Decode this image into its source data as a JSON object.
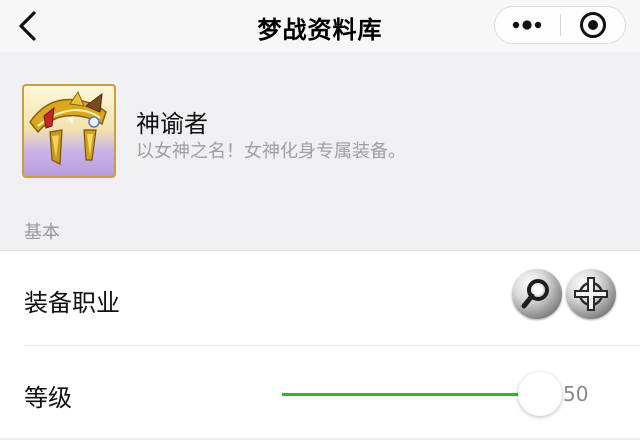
{
  "navbar": {
    "title": "梦战资料库",
    "back_icon": "chevron-left-icon",
    "menu_icon": "more-dots-icon",
    "close_icon": "target-circle-icon"
  },
  "item": {
    "name": "神谕者",
    "description": "以女神之名！女神化身专属装备。",
    "icon": "golden-circlet-icon"
  },
  "section": {
    "basic_label": "基本"
  },
  "rows": {
    "job_label": "装备职业",
    "job_icons": [
      "magnifier-job-icon",
      "holy-cross-job-icon"
    ],
    "level_label": "等级",
    "level_value": "50",
    "level_fraction": 1.0
  },
  "colors": {
    "accent": "#3cb034",
    "page_bg": "#efeff4",
    "navbar_bg": "#f7f7f7",
    "icon_frame": "#c8a13a"
  }
}
